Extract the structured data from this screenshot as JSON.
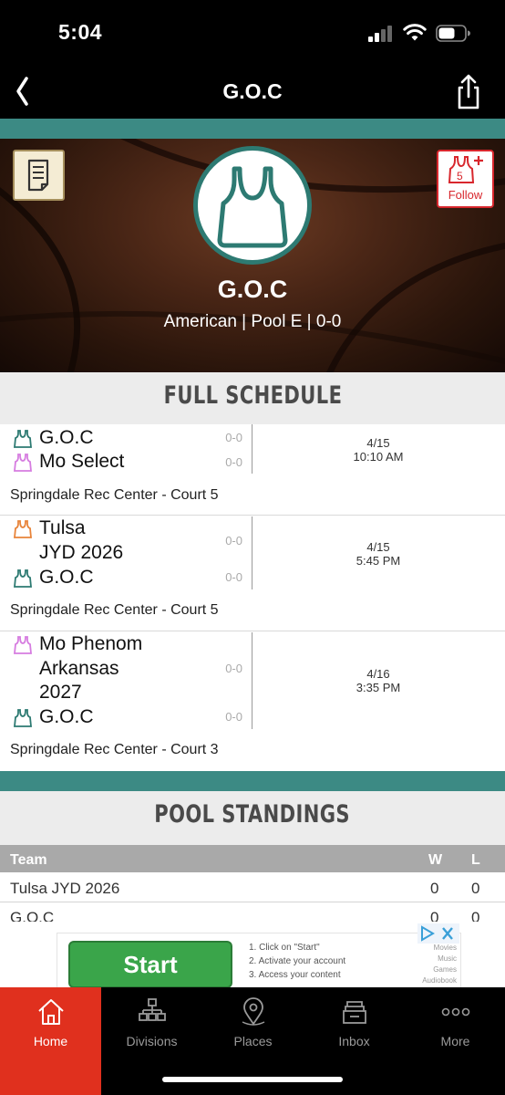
{
  "status_bar": {
    "time": "5:04"
  },
  "nav": {
    "title": "G.O.C"
  },
  "team": {
    "name": "G.O.C",
    "subtitle": "American | Pool E | 0-0",
    "follow_label": "Follow"
  },
  "schedule": {
    "title": "FULL SCHEDULE",
    "games": [
      {
        "teams": [
          {
            "name": "G.O.C",
            "record": "0-0",
            "color": "#2d7a72"
          },
          {
            "name": "Mo Select",
            "record": "0-0",
            "color": "#d67ce0"
          }
        ],
        "date": "4/15",
        "time": "10:10 AM",
        "location": "Springdale Rec Center - Court 5"
      },
      {
        "teams": [
          {
            "name": "Tulsa JYD 2026",
            "name_lines": [
              "Tulsa",
              "JYD 2026"
            ],
            "record": "0-0",
            "color": "#e8843a"
          },
          {
            "name": "G.O.C",
            "record": "0-0",
            "color": "#2d7a72"
          }
        ],
        "date": "4/15",
        "time": "5:45 PM",
        "location": "Springdale Rec Center - Court 5"
      },
      {
        "teams": [
          {
            "name": "Mo Phenom Arkansas 2027",
            "name_lines": [
              "Mo Phenom",
              "Arkansas",
              "2027"
            ],
            "record": "0-0",
            "color": "#d67ce0"
          },
          {
            "name": "G.O.C",
            "record": "0-0",
            "color": "#2d7a72"
          }
        ],
        "date": "4/16",
        "time": "3:35 PM",
        "location": "Springdale Rec Center - Court 3"
      }
    ]
  },
  "standings": {
    "title": "POOL STANDINGS",
    "columns": {
      "team": "Team",
      "wins": "W",
      "losses": "L"
    },
    "rows": [
      {
        "team": "Tulsa JYD 2026",
        "w": "0",
        "l": "0"
      },
      {
        "team": "G.O.C",
        "w": "0",
        "l": "0"
      }
    ]
  },
  "ad": {
    "button_label": "Start",
    "steps": [
      "1. Click on \"Start\"",
      "2. Activate your account",
      "3. Access your content"
    ],
    "side_text": [
      "Movies",
      "Music",
      "Games",
      "Audiobook"
    ]
  },
  "tabs": [
    {
      "label": "Home",
      "icon": "home-icon",
      "active": true
    },
    {
      "label": "Divisions",
      "icon": "bracket-icon",
      "active": false
    },
    {
      "label": "Places",
      "icon": "location-pin-icon",
      "active": false
    },
    {
      "label": "Inbox",
      "icon": "inbox-icon",
      "active": false
    },
    {
      "label": "More",
      "icon": "more-dots-icon",
      "active": false
    }
  ],
  "colors": {
    "teal": "#3c8a84",
    "accent_red": "#e0301e",
    "follow_red": "#d8272d"
  }
}
